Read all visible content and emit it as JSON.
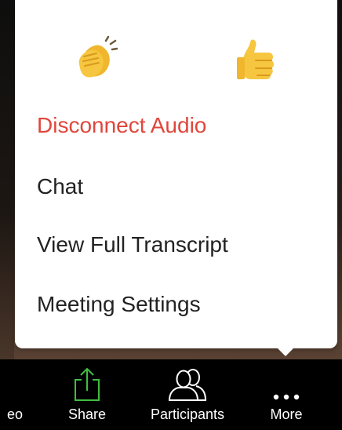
{
  "reactions": [
    {
      "name": "clapping-hands",
      "glyph": "👏"
    },
    {
      "name": "thumbs-up",
      "glyph": "👍"
    }
  ],
  "menu": {
    "items": [
      {
        "label": "Disconnect Audio",
        "color": "#e0463b"
      },
      {
        "label": "Chat"
      },
      {
        "label": "View Full Transcript"
      },
      {
        "label": "Meeting Settings"
      }
    ]
  },
  "toolbar": {
    "video_label": "eo",
    "share_label": "Share",
    "participants_label": "Participants",
    "more_label": "More",
    "share_icon_color": "#3fbf3f"
  }
}
